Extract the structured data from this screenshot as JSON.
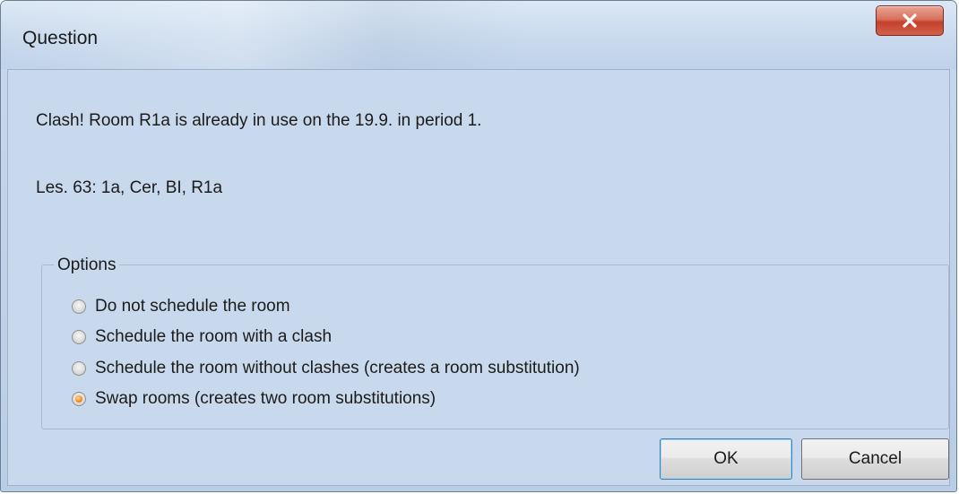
{
  "window": {
    "title": "Question",
    "close_icon": "close-x-icon"
  },
  "message": {
    "line1": "Clash! Room R1a is already in use on the 19.9. in period 1.",
    "line2": "Les. 63: 1a, Cer, BI, R1a"
  },
  "options": {
    "legend": "Options",
    "items": [
      {
        "label": "Do not schedule the room",
        "checked": false
      },
      {
        "label": "Schedule the room with a clash",
        "checked": false
      },
      {
        "label": "Schedule the room without clashes (creates a room substitution)",
        "checked": false
      },
      {
        "label": "Swap rooms (creates two room substitutions)",
        "checked": true
      }
    ]
  },
  "buttons": {
    "ok_label": "OK",
    "cancel_label": "Cancel"
  },
  "colors": {
    "radio_selected": "#f28a1c",
    "close_button": "#c4412c",
    "dialog_background": "#c9d9ed"
  }
}
